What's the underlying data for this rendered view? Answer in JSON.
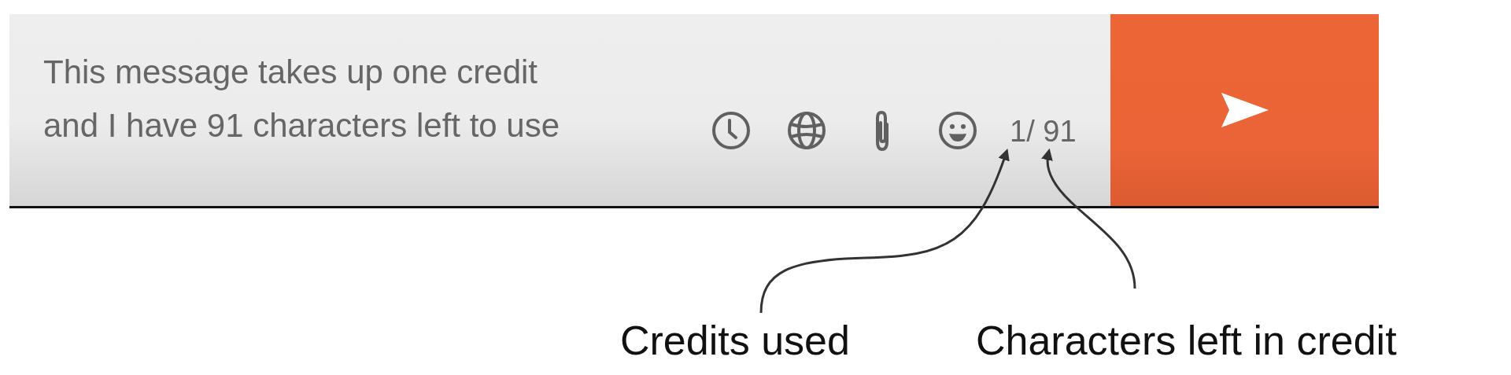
{
  "composer": {
    "message": "This message takes up one credit\nand I have 91 characters left to use",
    "tools": [
      {
        "kind": "clock"
      },
      {
        "kind": "globe"
      },
      {
        "kind": "paperclip"
      },
      {
        "kind": "smiley"
      }
    ],
    "counter": "1/ 91"
  },
  "annotations": [
    {
      "label": "Credits used"
    },
    {
      "label": "Characters left in credit"
    }
  ]
}
